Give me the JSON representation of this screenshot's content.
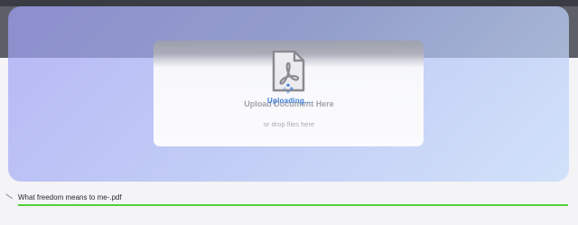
{
  "upload": {
    "status_text": "Uploading...",
    "title": "Upload Document Here",
    "hint": "or drop files here",
    "icon": "pdf-file-icon"
  },
  "file": {
    "name": "What freedom means to me-.pdf",
    "progress": 1.0
  },
  "colors": {
    "progress": "#4fd23a",
    "status": "#3f7fd8"
  }
}
